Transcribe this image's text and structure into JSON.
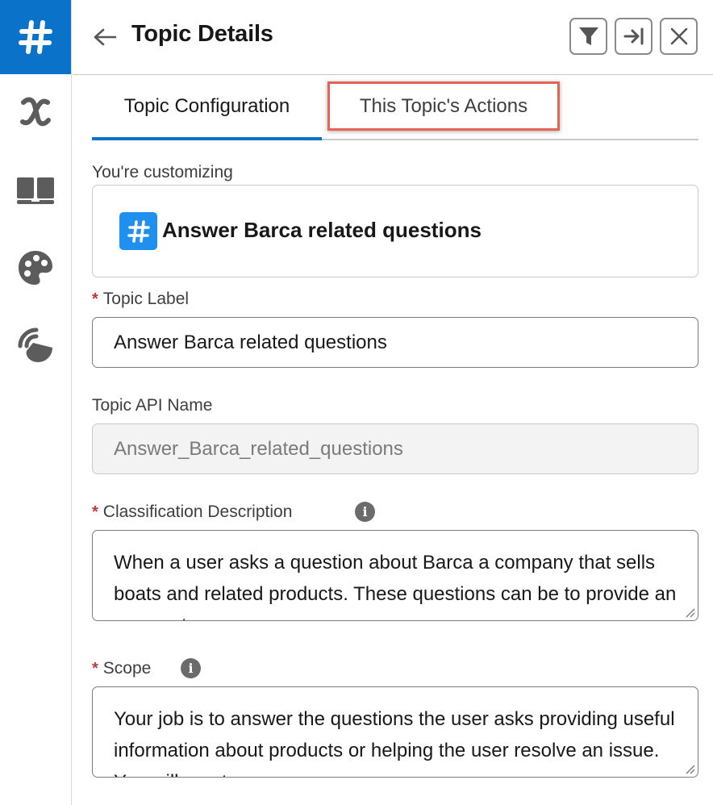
{
  "header": {
    "title": "Topic Details"
  },
  "tabs": [
    {
      "label": "Topic Configuration",
      "active": true
    },
    {
      "label": "This Topic's Actions",
      "active": false,
      "highlighted": true
    }
  ],
  "customizing": {
    "label": "You're customizing",
    "topic_name": "Answer Barca related questions"
  },
  "fields": {
    "topic_label": {
      "label": "Topic Label",
      "required": "*",
      "value": "Answer Barca related questions"
    },
    "api_name": {
      "label": "Topic API Name",
      "value": "Answer_Barca_related_questions"
    },
    "classification": {
      "label": "Classification Description",
      "required": "*",
      "info": "i",
      "value": "When a user asks a question about Barca a company that sells boats and related products. These questions can be to provide an answer to a"
    },
    "scope": {
      "label": "Scope",
      "required": "*",
      "info": "i",
      "value": "Your job is to answer the questions the user asks providing useful information about products or helping the user resolve an issue. You will create a"
    }
  },
  "colors": {
    "accent": "#0b72c9",
    "badge": "#1f8ff0",
    "highlight_border": "#e46458",
    "required": "#c23934"
  },
  "icons": {
    "rail": [
      "hash-icon",
      "variable-x-icon",
      "book-icon",
      "palette-icon",
      "connect-icon"
    ],
    "header": [
      "back-arrow-icon",
      "filter-icon",
      "expand-icon",
      "close-icon"
    ]
  }
}
